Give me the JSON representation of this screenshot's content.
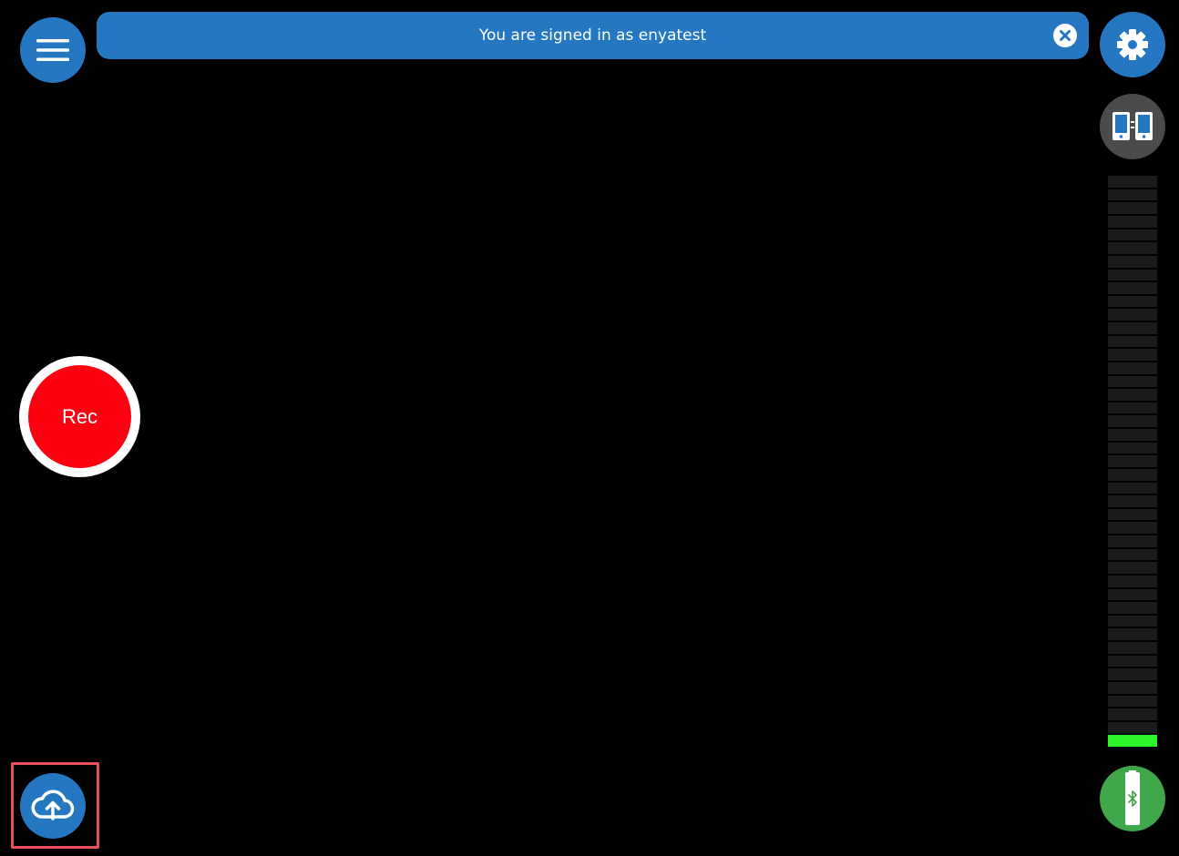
{
  "banner": {
    "message": "You are signed in as enyatest",
    "close_icon": "close-circle-icon"
  },
  "record": {
    "label": "Rec",
    "color": "#ff0011"
  },
  "toolbar": {
    "menu_icon": "hamburger-menu-icon",
    "settings_icon": "gear-icon",
    "devices_icon": "dual-device-icon",
    "battery_icon": "bluetooth-battery-icon",
    "upload_icon": "cloud-upload-icon"
  },
  "level_meter": {
    "segments": 43,
    "lit_segments": 1,
    "lit_color": "#2cf52c"
  },
  "colors": {
    "primary": "#2677c2",
    "background": "#000000",
    "highlight": "#e8505f",
    "battery": "#3fa74a"
  }
}
